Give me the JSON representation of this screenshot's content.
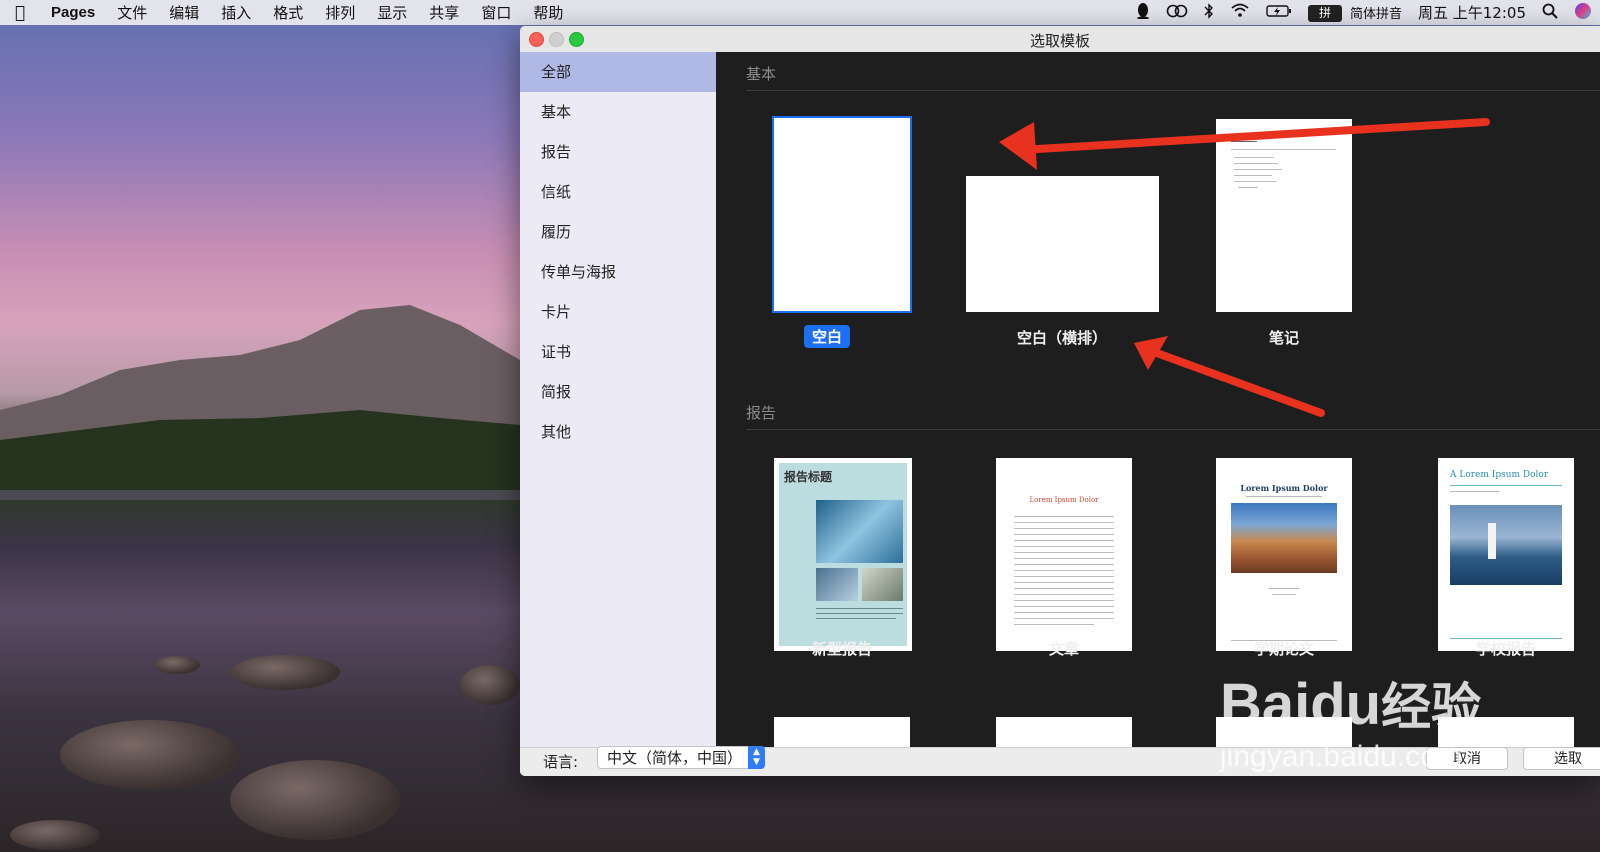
{
  "menubar": {
    "app": "Pages",
    "items": [
      "文件",
      "编辑",
      "插入",
      "格式",
      "排列",
      "显示",
      "共享",
      "窗口",
      "帮助"
    ],
    "input_method_badge": "拼",
    "input_method": "简体拼音",
    "clock": "周五 上午12:05"
  },
  "window": {
    "title": "选取模板",
    "sidebar": [
      "全部",
      "基本",
      "报告",
      "信纸",
      "履历",
      "传单与海报",
      "卡片",
      "证书",
      "简报",
      "其他"
    ],
    "sections": {
      "basic": "基本",
      "report": "报告"
    },
    "basic_templates": [
      "空白",
      "空白（横排）",
      "笔记"
    ],
    "report_templates": [
      "新型报告",
      "文章",
      "学期论文",
      "学校报告"
    ],
    "thumb_text": {
      "report_title": "报告标题",
      "essay_title": "Lorem Ipsum Dolor",
      "term_title": "Lorem Ipsum Dolor",
      "school_title": "A Lorem Ipsum Dolor"
    },
    "bottom": {
      "language_label": "语言:",
      "language_value": "中文（简体，中国）",
      "cancel_label": "取消",
      "choose_label": "选取"
    }
  },
  "watermark": {
    "brand": "Baidu",
    "cn": "经验",
    "url": "jingyan.baidu.com"
  },
  "colors": {
    "accent": "#1c6ff0",
    "arrow": "#e8321f",
    "sidebar_active": "#b0b8e6"
  }
}
